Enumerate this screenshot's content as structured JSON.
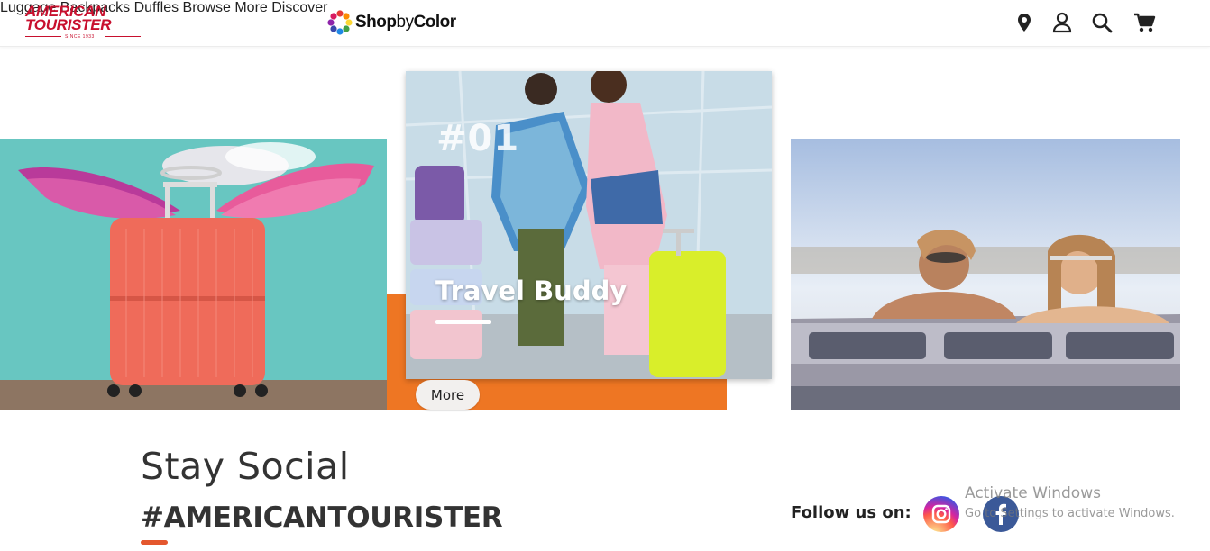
{
  "header": {
    "logo_line1": "AMERICAN",
    "logo_line2": "TOURISTER",
    "logo_since": "SINCE 1933",
    "shop_by_color_1": "Shop",
    "shop_by_color_2": "by",
    "shop_by_color_3": "Color",
    "nav": [
      {
        "label": "Luggage"
      },
      {
        "label": "Backpacks"
      },
      {
        "label": "Duffles"
      },
      {
        "label": "Browse More"
      },
      {
        "label": "Discover"
      }
    ],
    "icons": [
      "location-pin-icon",
      "user-icon",
      "search-icon",
      "cart-icon"
    ]
  },
  "banner": {
    "number": "#01",
    "title": "Travel Buddy",
    "more_label": "More",
    "accent_color": "#ee7623"
  },
  "social": {
    "heading": "Stay Social",
    "hashtag": "#AMERICANTOURISTER",
    "follow_label": "Follow us on:",
    "icons": [
      "instagram-icon",
      "facebook-icon"
    ]
  },
  "watermark": {
    "line1": "Activate Windows",
    "line2": "Go to Settings to activate Windows."
  },
  "colors": {
    "brand_red": "#c8102e",
    "accent_orange": "#ee7623",
    "hashtag_rule": "#e4572e"
  }
}
